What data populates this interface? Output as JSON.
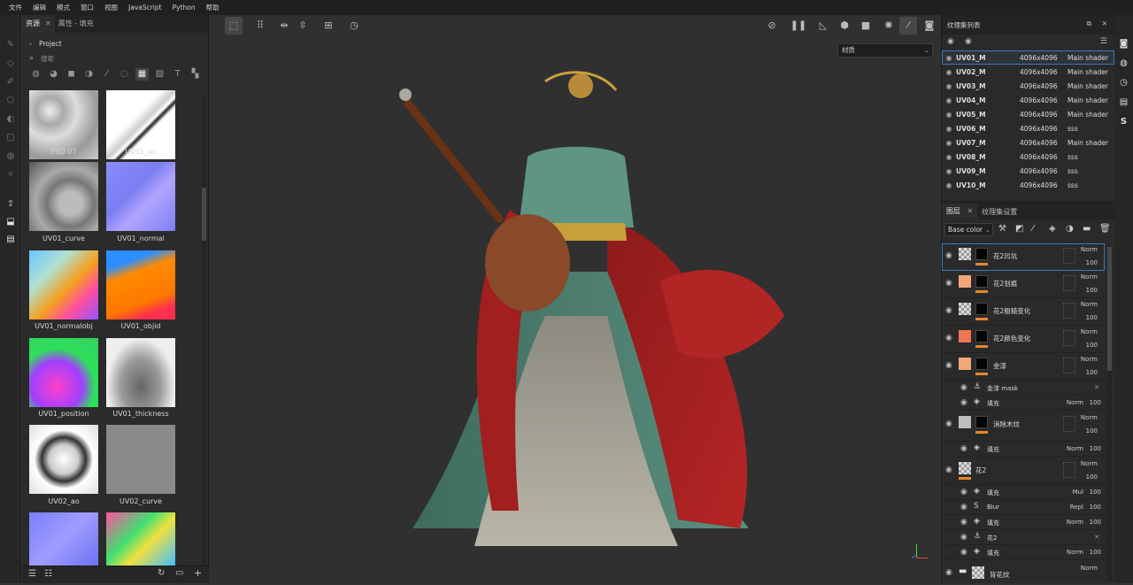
{
  "menu": [
    "文件",
    "编辑",
    "模式",
    "窗口",
    "视图",
    "JavaScript",
    "Python",
    "帮助"
  ],
  "assets_panel": {
    "tab_assets": "资源",
    "tab_props": "属性 - 填充",
    "project": "Project",
    "search_placeholder": "搜索",
    "items": [
      {
        "label": "PSD 07"
      },
      {
        "label": "UV01_ao"
      },
      {
        "label": "UV01_curve"
      },
      {
        "label": "UV01_normal"
      },
      {
        "label": "UV01_normalobj"
      },
      {
        "label": "UV01_objid"
      },
      {
        "label": "UV01_position"
      },
      {
        "label": "UV01_thickness"
      },
      {
        "label": "UV02_ao"
      },
      {
        "label": "UV02_curve"
      },
      {
        "label": ""
      },
      {
        "label": ""
      }
    ]
  },
  "viewport": {
    "material_select": "材质"
  },
  "texture_sets": {
    "title": "纹理集列表",
    "rows": [
      {
        "name": "UV01_M",
        "size": "4096x4096",
        "shader": "Main shader"
      },
      {
        "name": "UV02_M",
        "size": "4096x4096",
        "shader": "Main shader"
      },
      {
        "name": "UV03_M",
        "size": "4096x4096",
        "shader": "Main shader"
      },
      {
        "name": "UV04_M",
        "size": "4096x4096",
        "shader": "Main shader"
      },
      {
        "name": "UV05_M",
        "size": "4096x4096",
        "shader": "Main shader"
      },
      {
        "name": "UV06_M",
        "size": "4096x4096",
        "shader": "sss"
      },
      {
        "name": "UV07_M",
        "size": "4096x4096",
        "shader": "Main shader"
      },
      {
        "name": "UV08_M",
        "size": "4096x4096",
        "shader": "sss"
      },
      {
        "name": "UV09_M",
        "size": "4096x4096",
        "shader": "sss"
      },
      {
        "name": "UV10_M",
        "size": "4096x4096",
        "shader": "sss"
      }
    ]
  },
  "layers": {
    "tab_layers": "图层",
    "tab_settings": "纹理集设置",
    "channel": "Base color",
    "items": [
      {
        "name": "花2凹坑",
        "blend": "Norm",
        "opacity": "100",
        "swatch": "checker"
      },
      {
        "name": "花2划痕",
        "blend": "Norm",
        "opacity": "100",
        "swatch": "#f0a77a"
      },
      {
        "name": "花2粗糙变化",
        "blend": "Norm",
        "opacity": "100",
        "swatch": "checker"
      },
      {
        "name": "花2颜色变化",
        "blend": "Norm",
        "opacity": "100",
        "swatch": "#ef7652"
      },
      {
        "name": "金漆",
        "blend": "Norm",
        "opacity": "100",
        "swatch": "#f0a77a"
      },
      {
        "name": "消除木纹",
        "blend": "Norm",
        "opacity": "100",
        "swatch": "#bdbdbd"
      },
      {
        "name": "花2",
        "blend": "Norm",
        "opacity": "100",
        "swatch": "checker"
      },
      {
        "name": "背花纹",
        "blend": "Norm",
        "opacity": "",
        "swatch": "checker"
      }
    ],
    "subs": [
      {
        "name": "金漆 mask",
        "blend": "",
        "opacity": ""
      },
      {
        "name": "填充",
        "blend": "Norm",
        "opacity": "100"
      },
      {
        "name": "填充",
        "blend": "Norm",
        "opacity": "100"
      },
      {
        "name": "填充",
        "blend": "Mul",
        "opacity": "100"
      },
      {
        "name": "Blur",
        "blend": "Repl",
        "opacity": "100"
      },
      {
        "name": "填充",
        "blend": "Norm",
        "opacity": "100"
      },
      {
        "name": "花2",
        "blend": "",
        "opacity": ""
      },
      {
        "name": "填充",
        "blend": "Norm",
        "opacity": "100"
      }
    ]
  }
}
